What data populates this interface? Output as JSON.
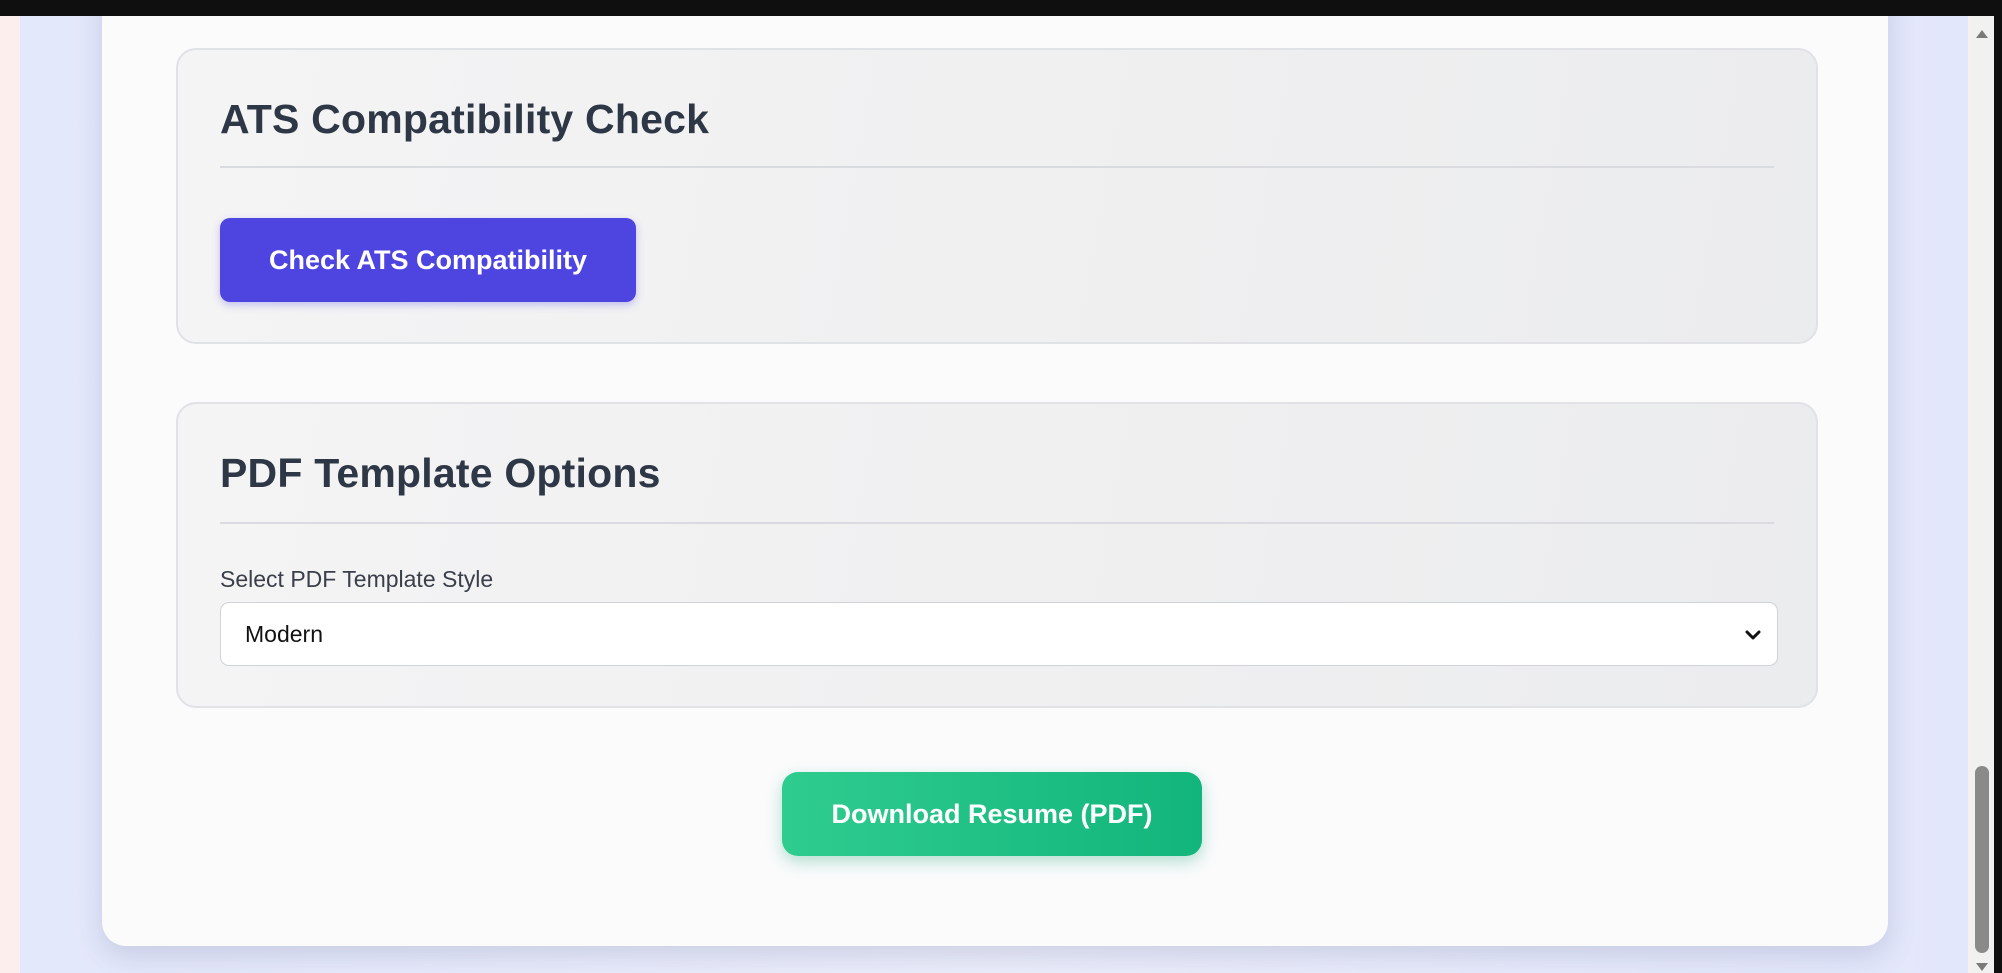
{
  "ats_section": {
    "title": "ATS Compatibility Check",
    "button_label": "Check ATS Compatibility"
  },
  "pdf_section": {
    "title": "PDF Template Options",
    "select_label": "Select PDF Template Style",
    "selected_option": "Modern"
  },
  "actions": {
    "download_label": "Download Resume (PDF)"
  },
  "colors": {
    "primary_button": "#4e44e0",
    "download_button": "#12b57c",
    "heading_text": "#2e3746"
  },
  "icons": {
    "select_arrow": "chevron-down-icon",
    "scroll_up": "arrow-up-icon",
    "scroll_down": "arrow-down-icon"
  }
}
